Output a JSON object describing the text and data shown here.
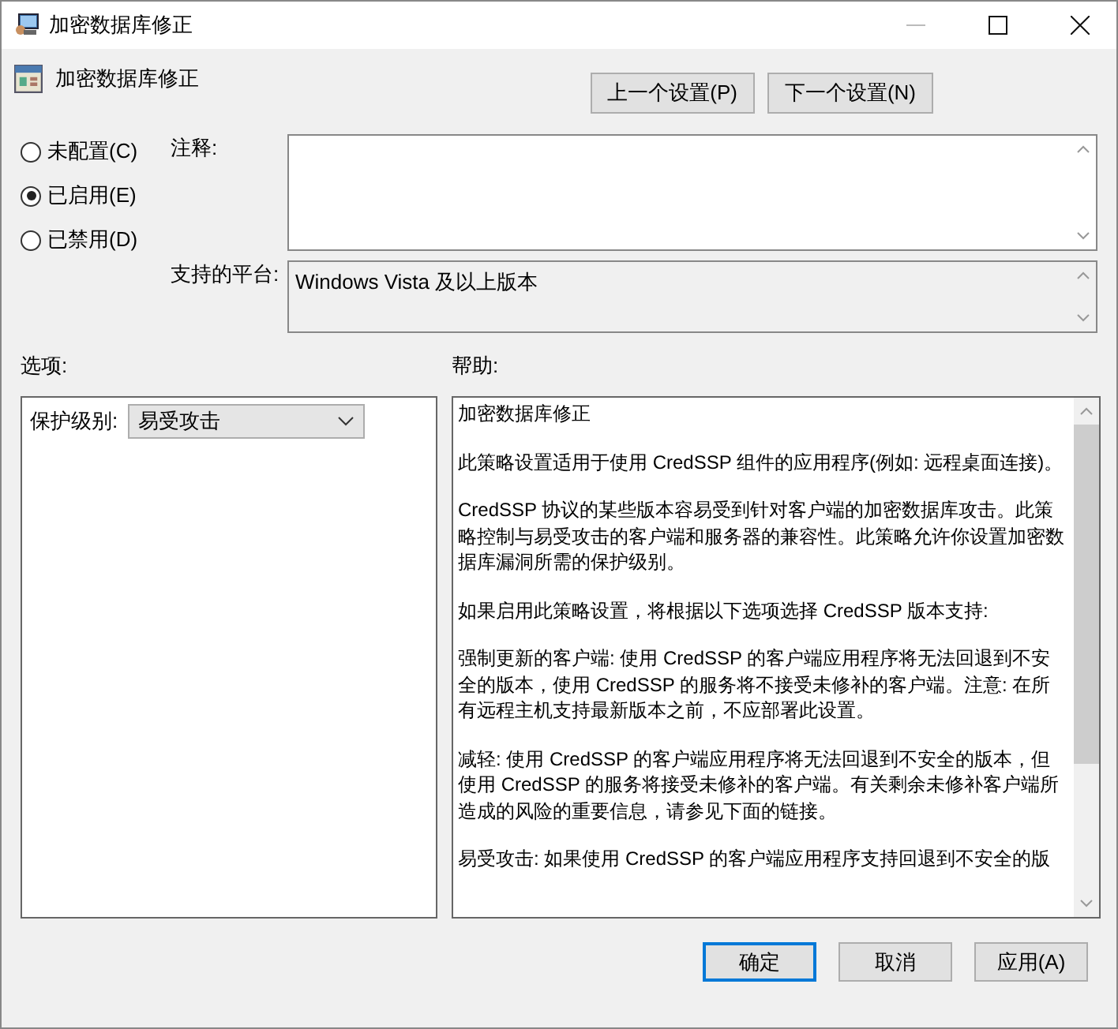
{
  "window": {
    "title": "加密数据库修正"
  },
  "header": {
    "title": "加密数据库修正"
  },
  "nav_buttons": [
    "上一个设置(P)",
    "下一个设置(N)"
  ],
  "radios": [
    {
      "label": "未配置(C)",
      "selected": false
    },
    {
      "label": "已启用(E)",
      "selected": true
    },
    {
      "label": "已禁用(D)",
      "selected": false
    }
  ],
  "comment": {
    "label": "注释:"
  },
  "platform": {
    "label": "支持的平台:",
    "value": "Windows Vista 及以上版本"
  },
  "options": {
    "label": "选项:",
    "field_label": "保护级别:",
    "value": "易受攻击"
  },
  "help": {
    "label": "帮助:",
    "paragraphs": [
      "加密数据库修正",
      "此策略设置适用于使用 CredSSP 组件的应用程序(例如: 远程桌面连接)。",
      "CredSSP 协议的某些版本容易受到针对客户端的加密数据库攻击。此策略控制与易受攻击的客户端和服务器的兼容性。此策略允许你设置加密数据库漏洞所需的保护级别。",
      "如果启用此策略设置，将根据以下选项选择 CredSSP 版本支持:",
      "强制更新的客户端: 使用 CredSSP 的客户端应用程序将无法回退到不安全的版本，使用 CredSSP 的服务将不接受未修补的客户端。注意: 在所有远程主机支持最新版本之前，不应部署此设置。",
      "减轻: 使用 CredSSP 的客户端应用程序将无法回退到不安全的版本，但使用 CredSSP 的服务将接受未修补的客户端。有关剩余未修补客户端所造成的风险的重要信息，请参见下面的链接。",
      "易受攻击: 如果使用 CredSSP 的客户端应用程序支持回退到不安全的版"
    ]
  },
  "buttons": [
    {
      "label": "确定",
      "kind": "default"
    },
    {
      "label": "取消",
      "kind": "normal"
    },
    {
      "label": "应用(A)",
      "kind": "normal"
    }
  ]
}
